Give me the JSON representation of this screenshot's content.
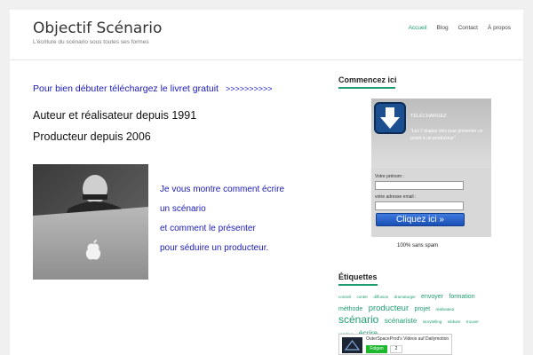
{
  "header": {
    "site_title": "Objectif Scénario",
    "tagline": "L'écriture du scénario sous toutes ses formes",
    "nav": [
      "Accueil",
      "Blog",
      "Contact",
      "À propos"
    ]
  },
  "main": {
    "promo_text": "Pour bien débuter téléchargez le livret gratuit",
    "promo_arrows": ">>>>>>>>>>",
    "line1": "Auteur et réalisateur depuis 1991",
    "line2": "Producteur depuis 2006",
    "right_lines": [
      "Je vous montre comment écrire",
      "un scénario",
      "et comment le présenter",
      "pour séduire un producteur."
    ]
  },
  "sidebar": {
    "start_title": "Commencez ici",
    "optin": {
      "label": "TÉLÉCHARGEZ",
      "desc": "\"Les 7 étapes clés pour présenter un projet à un producteur\"",
      "firstname_label": "Votre prénom :",
      "email_label": "votre adresse email :",
      "button": "Cliquez ici »"
    },
    "nospam": "100% sans spam",
    "tags_title": "Étiquettes",
    "tags": [
      {
        "t": "conseil",
        "s": 4.5,
        "c": "#1e9e6e"
      },
      {
        "t": "conter",
        "s": 4.5,
        "c": "#1e9e6e"
      },
      {
        "t": "diffusion",
        "s": 4.5,
        "c": "#1e9e6e"
      },
      {
        "t": "dramaturgie",
        "s": 4.5,
        "c": "#1e9e6e"
      },
      {
        "t": "envoyer",
        "s": 7,
        "c": "#1e9e6e"
      },
      {
        "t": "formation",
        "s": 7,
        "c": "#1e9e6e"
      },
      {
        "t": "méthode",
        "s": 7,
        "c": "#1e9e6e"
      },
      {
        "t": "producteur",
        "s": 9.5,
        "c": "#1e9e6e"
      },
      {
        "t": "projet",
        "s": 7,
        "c": "#1e9e6e"
      },
      {
        "t": "réalisateur",
        "s": 4.5,
        "c": "#1e9e6e"
      },
      {
        "t": "scénario",
        "s": 12,
        "c": "#1e9e6e"
      },
      {
        "t": "scénariste",
        "s": 8,
        "c": "#1e9e6e"
      },
      {
        "t": "storytelling",
        "s": 4.5,
        "c": "#1e9e6e"
      },
      {
        "t": "séduire",
        "s": 4.5,
        "c": "#1e9e6e"
      },
      {
        "t": "trouver",
        "s": 4.5,
        "c": "#1e9e6e"
      },
      {
        "t": "vendeur",
        "s": 4.5,
        "c": "#1e9e6e"
      },
      {
        "t": "écrire",
        "s": 8.5,
        "c": "#1e9e6e"
      }
    ],
    "widget": {
      "name": "OuterSpaceProd's Videos auf Dailymotion",
      "follow": "Folgen",
      "count": "2"
    }
  },
  "colors": {
    "accent": "#1e9e6e",
    "link": "#1a1ab8"
  },
  "icons": {
    "download": "download-arrow-icon",
    "apple": "apple-logo-icon"
  }
}
